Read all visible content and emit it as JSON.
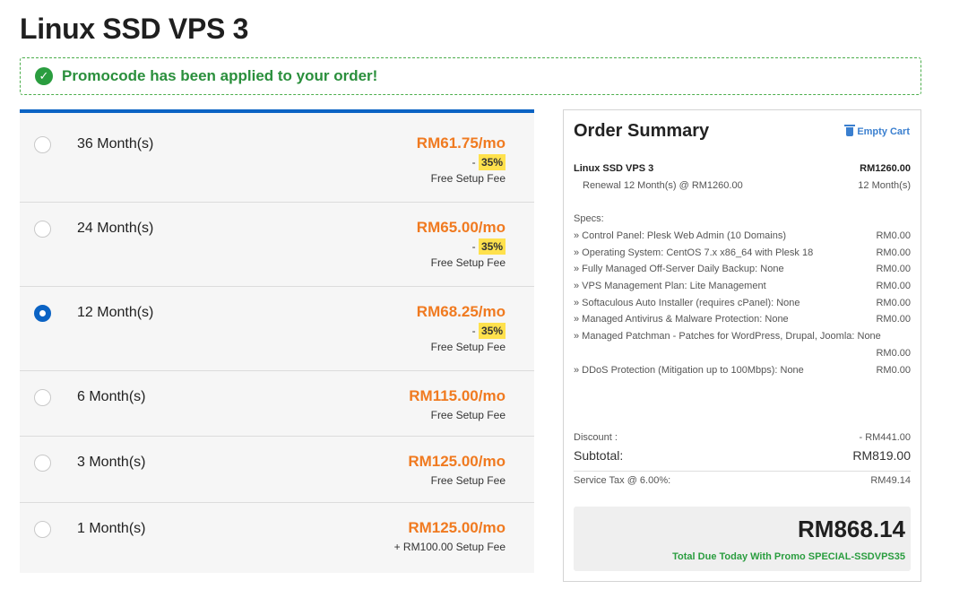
{
  "page": {
    "title": "Linux SSD VPS 3"
  },
  "promo": {
    "message": "Promocode has been applied to your order!"
  },
  "cycles": [
    {
      "label": "36 Month(s)",
      "price": "RM61.75/mo",
      "discount_prefix": "- ",
      "discount": "35%",
      "fee": "Free Setup Fee",
      "selected": false
    },
    {
      "label": "24 Month(s)",
      "price": "RM65.00/mo",
      "discount_prefix": "- ",
      "discount": "35%",
      "fee": "Free Setup Fee",
      "selected": false
    },
    {
      "label": "12 Month(s)",
      "price": "RM68.25/mo",
      "discount_prefix": "- ",
      "discount": "35%",
      "fee": "Free Setup Fee",
      "selected": true
    },
    {
      "label": "6 Month(s)",
      "price": "RM115.00/mo",
      "fee": "Free Setup Fee",
      "selected": false
    },
    {
      "label": "3 Month(s)",
      "price": "RM125.00/mo",
      "fee": "Free Setup Fee",
      "selected": false
    },
    {
      "label": "1 Month(s)",
      "price": "RM125.00/mo",
      "fee": "+ RM100.00 Setup Fee",
      "selected": false
    }
  ],
  "summary": {
    "title": "Order Summary",
    "empty_cart": "Empty Cart",
    "product_name": "Linux SSD VPS 3",
    "product_price": "RM1260.00",
    "renewal": "Renewal 12 Month(s) @ RM1260.00",
    "renewal_cycle": "12 Month(s)",
    "specs_label": "Specs:",
    "specs": [
      {
        "label": "» Control Panel: Plesk Web Admin (10 Domains)",
        "price": "RM0.00"
      },
      {
        "label": "» Operating System: CentOS 7.x x86_64 with Plesk 18",
        "price": "RM0.00"
      },
      {
        "label": "» Fully Managed Off-Server Daily Backup: None",
        "price": "RM0.00"
      },
      {
        "label": "» VPS Management Plan: Lite Management",
        "price": "RM0.00"
      },
      {
        "label": "» Softaculous Auto Installer (requires cPanel): None",
        "price": "RM0.00"
      },
      {
        "label": "» Managed Antivirus & Malware Protection: None",
        "price": "RM0.00"
      },
      {
        "label": "» Managed Patchman - Patches for WordPress, Drupal, Joomla: None",
        "price": "RM0.00"
      },
      {
        "label": "» DDoS Protection (Mitigation up to 100Mbps): None",
        "price": "RM0.00"
      }
    ],
    "discount_label": "Discount :",
    "discount_value": "- RM441.00",
    "subtotal_label": "Subtotal:",
    "subtotal_value": "RM819.00",
    "tax_label": "Service Tax @ 6.00%:",
    "tax_value": "RM49.14",
    "total_amount": "RM868.14",
    "total_label": "Total Due Today With Promo SPECIAL-SSDVPS35"
  },
  "colors": {
    "accent": "#0b63c4",
    "price": "#f07a20",
    "success": "#2a9d3f",
    "badge": "#ffe14d"
  }
}
